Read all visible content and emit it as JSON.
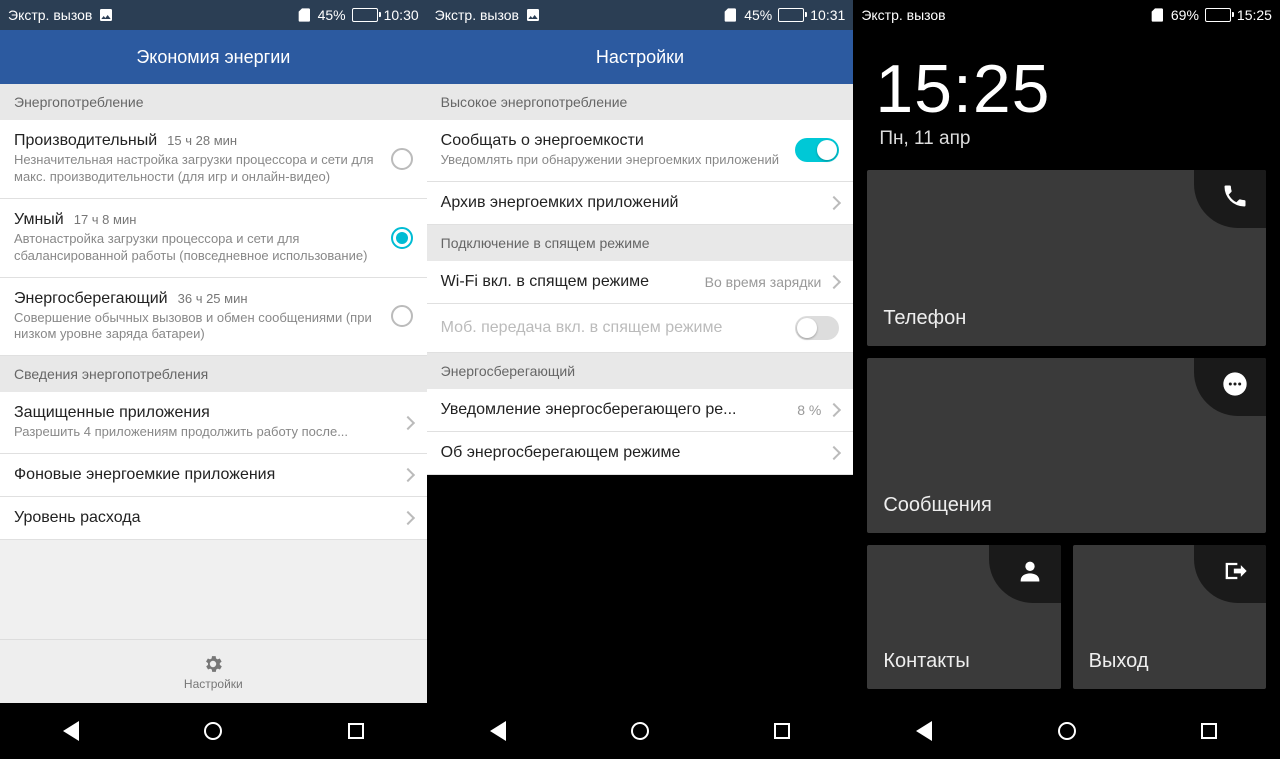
{
  "phone1": {
    "status": {
      "carrier": "Экстр. вызов",
      "battery_pct": "45%",
      "time": "10:30",
      "battery_fill": 45
    },
    "header": "Экономия энергии",
    "sec1": "Энергопотребление",
    "modes": [
      {
        "title": "Производительный",
        "time": "15 ч 28 мин",
        "desc": "Незначительная настройка загрузки процессора и сети для макс. производительности (для игр и онлайн-видео)",
        "selected": false
      },
      {
        "title": "Умный",
        "time": "17 ч 8 мин",
        "desc": "Автонастройка загрузки процессора и сети для сбалансированной работы (повседневное использование)",
        "selected": true
      },
      {
        "title": "Энергосберегающий",
        "time": "36 ч 25 мин",
        "desc": "Совершение обычных вызовов и обмен сообщениями (при низком уровне заряда батареи)",
        "selected": false
      }
    ],
    "sec2": "Сведения энергопотребления",
    "rows": [
      {
        "title": "Защищенные приложения",
        "desc": "Разрешить 4 приложениям продолжить работу после..."
      },
      {
        "title": "Фоновые энергоемкие приложения"
      },
      {
        "title": "Уровень расхода"
      }
    ],
    "bottom_label": "Настройки"
  },
  "phone2": {
    "status": {
      "carrier": "Экстр. вызов",
      "battery_pct": "45%",
      "time": "10:31",
      "battery_fill": 45
    },
    "header": "Настройки",
    "sec1": "Высокое энергопотребление",
    "row_notify": {
      "title": "Сообщать о энергоемкости",
      "desc": "Уведомлять при обнаружении энергоемких приложений"
    },
    "row_archive": "Архив энергоемких приложений",
    "sec2": "Подключение в спящем режиме",
    "row_wifi": {
      "title": "Wi-Fi вкл. в спящем режиме",
      "value": "Во время зарядки"
    },
    "row_mobile": "Моб. передача вкл. в спящем режиме",
    "sec3": "Энергосберегающий",
    "row_saver_notif": {
      "title": "Уведомление энергосберегающего ре...",
      "value": "8 %"
    },
    "row_about": "Об энергосберегающем режиме"
  },
  "phone3": {
    "status": {
      "carrier": "Экстр. вызов",
      "battery_pct": "69%",
      "time": "15:25",
      "battery_fill": 69
    },
    "clock": "15:25",
    "date": "Пн, 11 апр",
    "tiles": {
      "phone": "Телефон",
      "messages": "Сообщения",
      "contacts": "Контакты",
      "exit": "Выход"
    }
  }
}
